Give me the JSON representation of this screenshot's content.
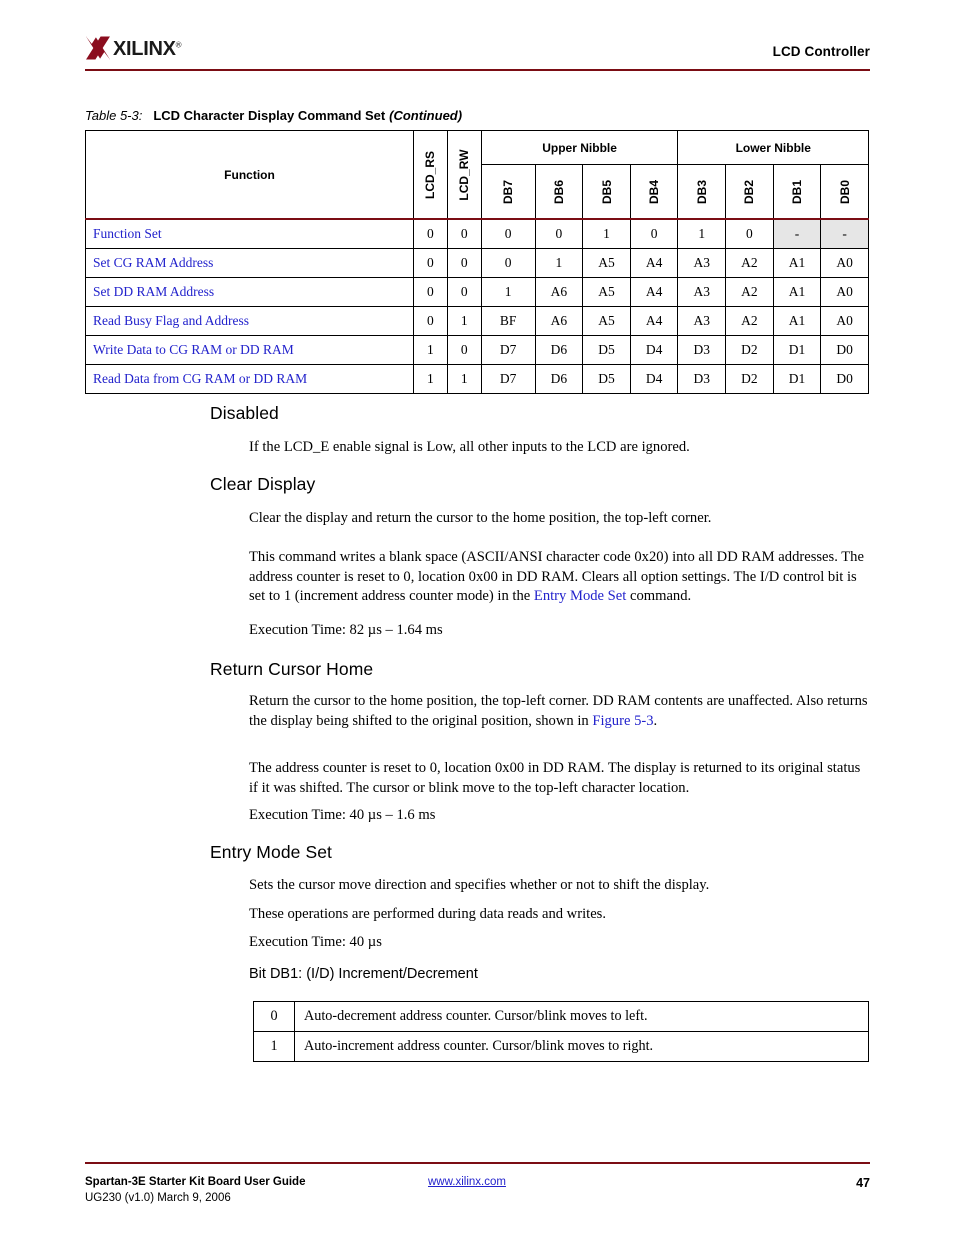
{
  "header": {
    "logo_text": "XILINX",
    "logo_reg": "®",
    "title": "LCD Controller",
    "rule_color": "#7b0d14"
  },
  "table_caption": {
    "number": "Table 5-3:",
    "title": "LCD Character Display Command Set",
    "continued": "(Continued)"
  },
  "command_table": {
    "col_function": "Function",
    "col_lcd_rs": "LCD_RS",
    "col_lcd_rw": "LCD_RW",
    "group_upper": "Upper Nibble",
    "group_lower": "Lower Nibble",
    "db_headers": [
      "DB7",
      "DB6",
      "DB5",
      "DB4",
      "DB3",
      "DB2",
      "DB1",
      "DB0"
    ],
    "link_color": "#2222cc",
    "shaded_color": "#e6e6e6",
    "rows": [
      {
        "function": "Function Set",
        "rs": "0",
        "rw": "0",
        "bits": [
          "0",
          "0",
          "1",
          "0",
          "1",
          "0",
          "-",
          "-"
        ],
        "shaded": [
          false,
          false,
          false,
          false,
          false,
          false,
          true,
          true
        ]
      },
      {
        "function": "Set CG RAM Address",
        "rs": "0",
        "rw": "0",
        "bits": [
          "0",
          "1",
          "A5",
          "A4",
          "A3",
          "A2",
          "A1",
          "A0"
        ],
        "shaded": [
          false,
          false,
          false,
          false,
          false,
          false,
          false,
          false
        ]
      },
      {
        "function": "Set DD RAM Address",
        "rs": "0",
        "rw": "0",
        "bits": [
          "1",
          "A6",
          "A5",
          "A4",
          "A3",
          "A2",
          "A1",
          "A0"
        ],
        "shaded": [
          false,
          false,
          false,
          false,
          false,
          false,
          false,
          false
        ]
      },
      {
        "function": "Read Busy Flag and Address",
        "rs": "0",
        "rw": "1",
        "bits": [
          "BF",
          "A6",
          "A5",
          "A4",
          "A3",
          "A2",
          "A1",
          "A0"
        ],
        "shaded": [
          false,
          false,
          false,
          false,
          false,
          false,
          false,
          false
        ]
      },
      {
        "function": "Write Data to CG RAM or DD RAM",
        "rs": "1",
        "rw": "0",
        "bits": [
          "D7",
          "D6",
          "D5",
          "D4",
          "D3",
          "D2",
          "D1",
          "D0"
        ],
        "shaded": [
          false,
          false,
          false,
          false,
          false,
          false,
          false,
          false
        ]
      },
      {
        "function": "Read Data from CG RAM or DD RAM",
        "rs": "1",
        "rw": "1",
        "bits": [
          "D7",
          "D6",
          "D5",
          "D4",
          "D3",
          "D2",
          "D1",
          "D0"
        ],
        "shaded": [
          false,
          false,
          false,
          false,
          false,
          false,
          false,
          false
        ]
      }
    ]
  },
  "sections": {
    "disabled": {
      "heading": "Disabled",
      "p1": "If the LCD_E enable signal is Low, all other inputs to the LCD are ignored."
    },
    "clear_display": {
      "heading": "Clear Display",
      "p1": "Clear the display and return the cursor to the home position, the top-left corner.",
      "p2_a": "This command writes a blank space (ASCII/ANSI character code 0x20) into all DD RAM addresses. The address counter is reset to 0, location 0x00 in DD RAM. Clears all option settings. The I/D control bit is set to 1 (increment address counter mode) in the ",
      "p2_link": "Entry Mode Set",
      "p2_b": " command.",
      "p3": "Execution Time: 82 µs – 1.64 ms"
    },
    "return_cursor_home": {
      "heading": "Return Cursor Home",
      "p1_a": "Return the cursor to the home position, the top-left corner. DD RAM contents are unaffected. Also returns the display being shifted to the original position, shown in ",
      "p1_link": "Figure 5-3",
      "p1_b": ".",
      "p2": "The address counter is reset to 0, location 0x00 in DD RAM. The display is returned to its original status if it was shifted. The cursor or blink move to the top-left character location.",
      "p3": "Execution Time: 40 µs – 1.6 ms"
    },
    "entry_mode_set": {
      "heading": "Entry Mode Set",
      "p1": "Sets the cursor move direction and specifies whether or not to shift the display.",
      "p2": "These operations are performed during data reads and writes.",
      "p3": "Execution Time: 40 µs",
      "subheading": "Bit DB1: (I/D) Increment/Decrement"
    }
  },
  "bit_table": {
    "rows": [
      {
        "value": "0",
        "description": "Auto-decrement address counter. Cursor/blink moves to left."
      },
      {
        "value": "1",
        "description": "Auto-increment address counter. Cursor/blink moves to right."
      }
    ]
  },
  "footer": {
    "guide": "Spartan-3E Starter Kit Board User Guide",
    "doc_id": "UG230 (v1.0) March 9, 2006",
    "url": "www.xilinx.com",
    "page": "47"
  }
}
